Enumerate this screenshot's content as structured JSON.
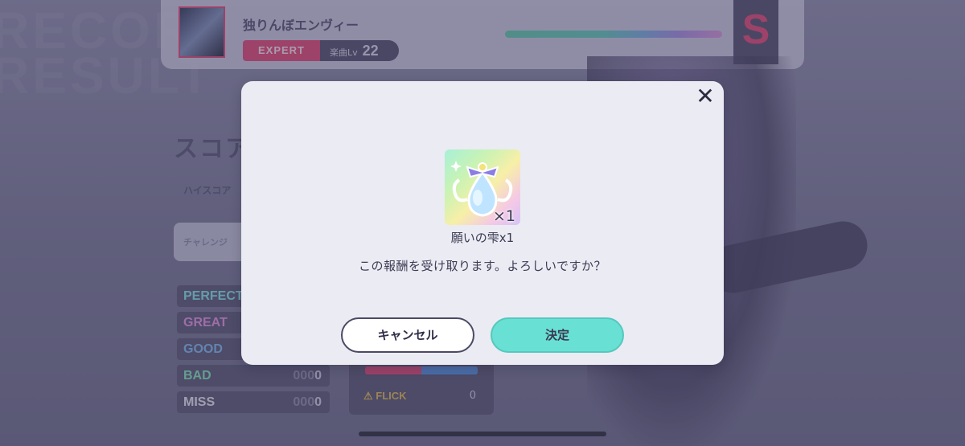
{
  "background": {
    "bg_text": "RECORD RESULT",
    "song_title": "独りんぼエンヴィー",
    "difficulty": "EXPERT",
    "level_label": "楽曲Lv",
    "level_value": "22",
    "rank": "S",
    "score_heading": "スコア",
    "hiscore_label": "ハイスコア",
    "challenge_label": "チャレンジ",
    "judgements": [
      {
        "label": "PERFECT",
        "color": "#7fe3e0",
        "count": ""
      },
      {
        "label": "GREAT",
        "color": "#e58fe0",
        "count": ""
      },
      {
        "label": "GOOD",
        "color": "#7bb8ee",
        "count": ""
      },
      {
        "label": "BAD",
        "color": "#7fe6b4",
        "count_dim": "000",
        "count": "0"
      },
      {
        "label": "MISS",
        "color": "#e8e8f0",
        "count_dim": "000",
        "count": "0"
      }
    ],
    "flick_label": "FLICK",
    "flick_value": "0"
  },
  "dialog": {
    "close_icon": "close-icon",
    "item": {
      "icon": "wish-drop-icon",
      "quantity": "×1",
      "name": "願いの雫x1"
    },
    "message": "この報酬を受け取ります。よろしいですか？",
    "cancel_label": "キャンセル",
    "confirm_label": "決定"
  },
  "colors": {
    "accent_confirm": "#69e0d4",
    "expert": "#e4416d",
    "dialog_bg": "#ebebf3"
  }
}
